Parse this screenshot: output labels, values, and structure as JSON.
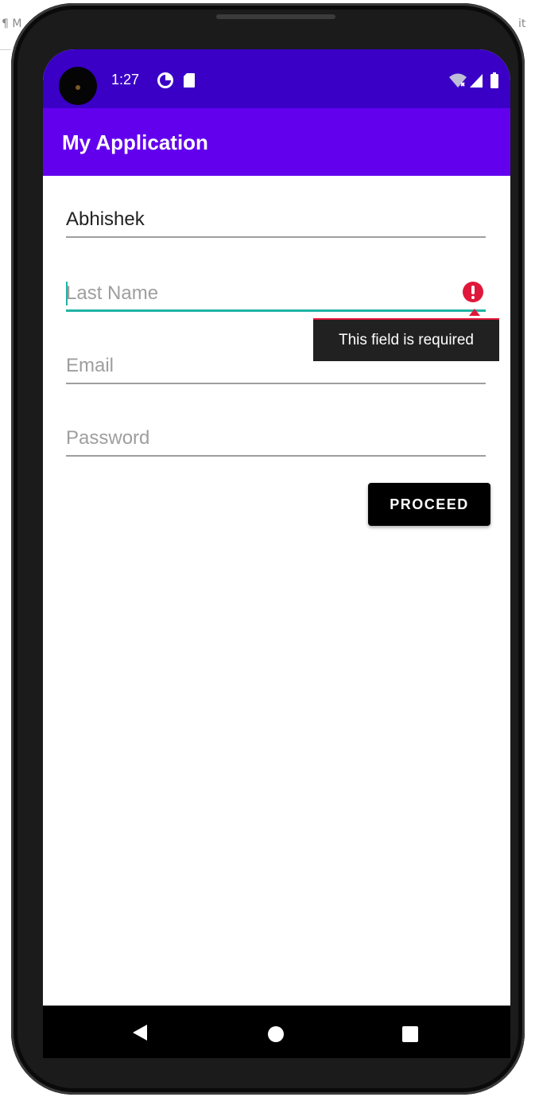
{
  "background": {
    "left_fragment": "¶ M",
    "right_fragment": "it"
  },
  "status_bar": {
    "time": "1:27",
    "left_icons": [
      "data-saver-icon",
      "sd-card-icon"
    ],
    "right_icons": [
      "wifi-icon",
      "signal-icon",
      "battery-icon"
    ]
  },
  "app_bar": {
    "title": "My Application"
  },
  "form": {
    "first_name": {
      "value": "Abhishek",
      "placeholder": ""
    },
    "last_name": {
      "value": "",
      "placeholder": "Last Name",
      "error": "This field is required"
    },
    "email": {
      "value": "",
      "placeholder": "Email"
    },
    "password": {
      "value": "",
      "placeholder": "Password"
    }
  },
  "proceed_button": {
    "label": "PROCEED"
  },
  "nav_bar": {
    "icons": [
      "back-icon",
      "home-icon",
      "recents-icon"
    ]
  },
  "colors": {
    "status_bar": "#3a00c6",
    "app_bar": "#6200ee",
    "field_focus": "#1fb3a4",
    "error": "#e0173a",
    "tooltip": "#212121",
    "button": "#000000"
  }
}
